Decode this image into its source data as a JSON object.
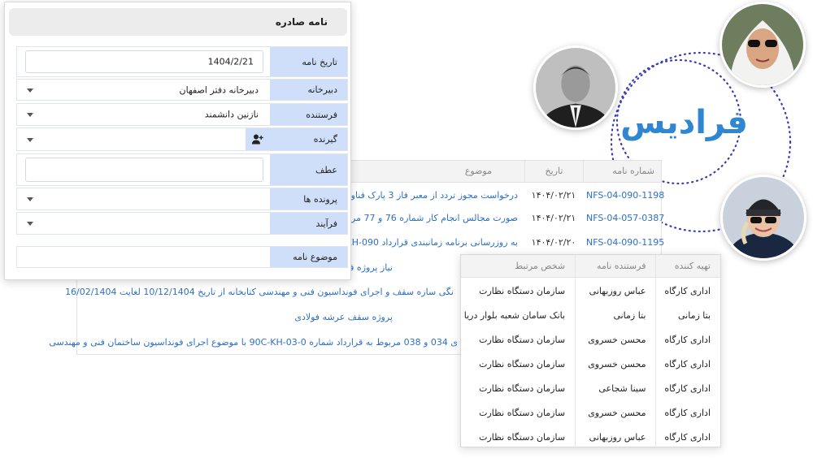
{
  "brand": {
    "logo_text": "فرادیس",
    "accent": "#2f86d1",
    "ring_color": "#3b3bb5"
  },
  "avatars": [
    {
      "name": "avatar-woman-hijab"
    },
    {
      "name": "avatar-man-suit"
    },
    {
      "name": "avatar-woman-beanie"
    }
  ],
  "letters_table": {
    "headers": {
      "number": "شماره نامه",
      "date": "تاریخ",
      "subject": "موضوع"
    },
    "rows": [
      {
        "number": "NFS-04-090-1198",
        "date": "۱۴۰۴/۰۲/۲۱",
        "subject": "درخواست مجوز تردد از معبر فاز 3 پارک فناوری (گ"
      },
      {
        "number": "NFS-04-057-0387",
        "date": "۱۴۰۴/۰۲/۲۱",
        "subject": "صورت مجالس انجام کار شماره 76 و 77 مربوط به"
      },
      {
        "number": "NFS-04-090-1195",
        "date": "۱۴۰۴/۰۲/۲۰",
        "subject": "به روزرسانی برنامه زمانبندی قرارداد 090-0C-KH"
      }
    ],
    "extra_subjects": [
      "نیاز پروژه فنی و مهندسی",
      "نگی سازه سقف و اجرای فونداسیون فنی و مهندسی کتابخانه از تاریخ 10/12/1404 لغایت 16/02/1404",
      "پروژه سقف عرشه فولادی",
      "ی 034 و 038 مربوط به قرارداد شماره 0-90C-KH-03 با موضوع اجرای فونداسیون ساختمان فنی و مهندسی"
    ]
  },
  "form": {
    "title": "نامه صادره",
    "fields": {
      "date": {
        "label": "تاریخ نامه",
        "value": "1404/2/21"
      },
      "office": {
        "label": "دبیرخانه",
        "value": "دبیرخانه دفتر اصفهان"
      },
      "sender": {
        "label": "فرستنده",
        "value": "نازنین دانشمند"
      },
      "receiver": {
        "label": "گیرنده",
        "value": ""
      },
      "reference": {
        "label": "عطف",
        "value": ""
      },
      "files": {
        "label": "پرونده ها",
        "value": ""
      },
      "process": {
        "label": "فرآیند",
        "value": ""
      },
      "subject": {
        "label": "موضوع نامه",
        "value": ""
      }
    }
  },
  "people_table": {
    "headers": {
      "preparer": "تهیه کننده",
      "sender": "فرستنده نامه",
      "related": "شخص مرتبط"
    },
    "rows": [
      {
        "preparer": "اداری کارگاه",
        "sender": "عباس روزبهانی",
        "related": "سازمان دستگاه نظارت"
      },
      {
        "preparer": "بتا زمانی",
        "sender": "بتا زمانی",
        "related": "بانک سامان شعبه بلوار دریا"
      },
      {
        "preparer": "اداری کارگاه",
        "sender": "محسن خسروی",
        "related": "سازمان دستگاه نظارت"
      },
      {
        "preparer": "اداری کارگاه",
        "sender": "محسن خسروی",
        "related": "سازمان دستگاه نظارت"
      },
      {
        "preparer": "اداری کارگاه",
        "sender": "سینا شجاعی",
        "related": "سازمان دستگاه نظارت"
      },
      {
        "preparer": "اداری کارگاه",
        "sender": "محسن خسروی",
        "related": "سازمان دستگاه نظارت"
      },
      {
        "preparer": "اداری کارگاه",
        "sender": "عباس روزبهانی",
        "related": "سازمان دستگاه نظارت"
      }
    ]
  }
}
